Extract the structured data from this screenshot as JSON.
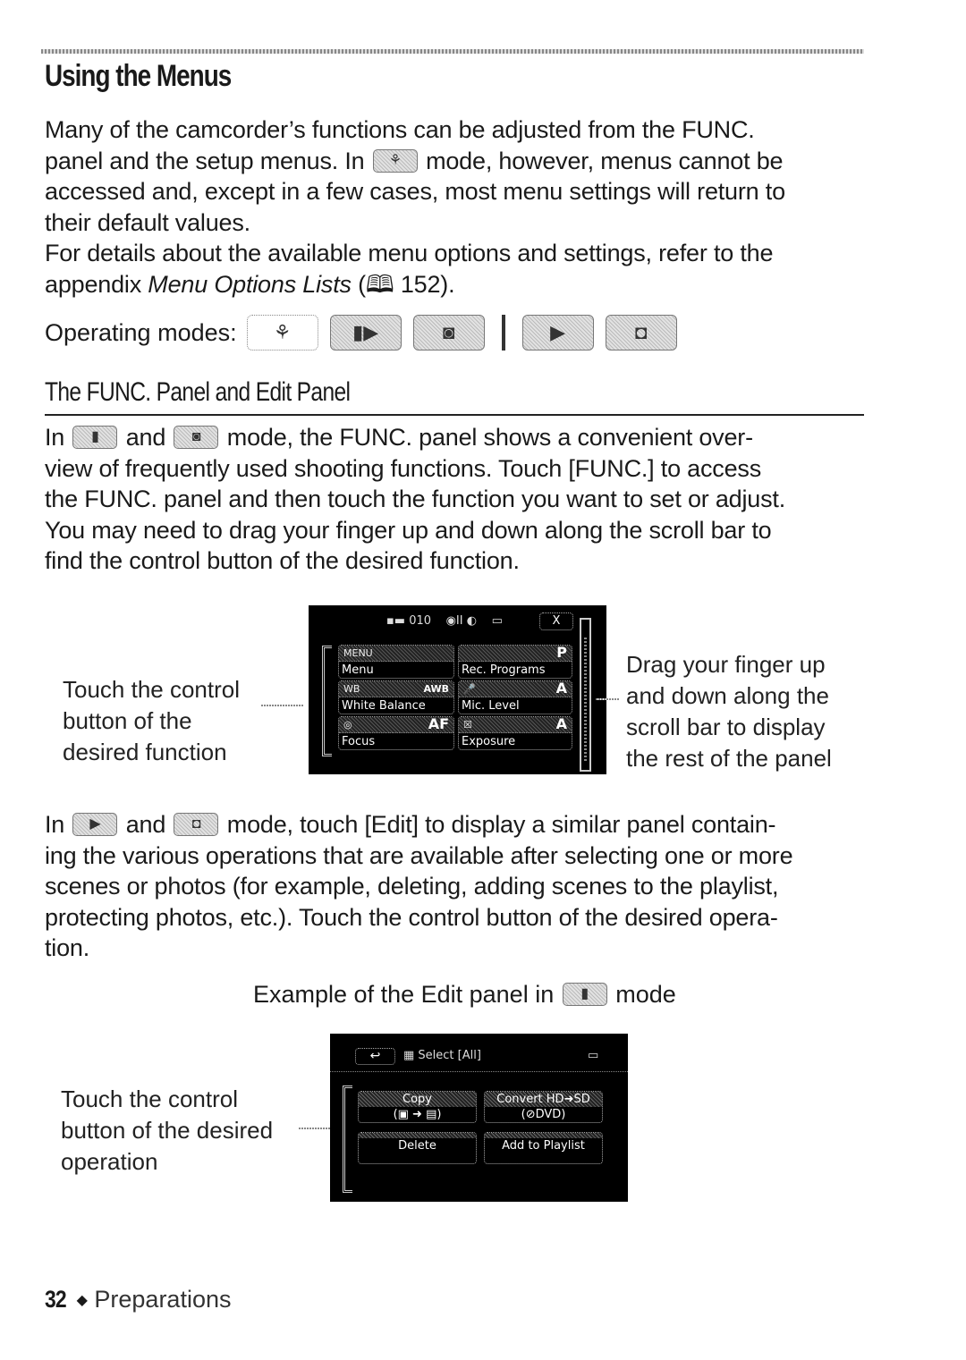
{
  "page": {
    "title": "Using the Menus",
    "intro_lines": [
      "Many of the camcorder’s functions can be adjusted from the FUNC.",
      [
        "panel and the setup menus. In ",
        "mode, however, menus cannot be"
      ],
      "accessed and, except in a few cases, most menu settings will return to",
      "their default values.",
      "For details about the available menu options and settings, refer to the",
      [
        "appendix ",
        "Menu Options Lists",
        " (",
        "📖",
        " 152)."
      ]
    ],
    "operating_modes_label": "Operating modes:",
    "modes": [
      {
        "icon": "auto-mode-icon",
        "glyph": "⚘",
        "active": false
      },
      {
        "icon": "movie-record-icon",
        "glyph": "🎥",
        "active": true
      },
      {
        "icon": "photo-record-icon",
        "glyph": "📷",
        "active": true
      },
      {
        "icon": "movie-playback-icon",
        "glyph": "▶",
        "active": true
      },
      {
        "icon": "photo-playback-icon",
        "glyph": "▶",
        "active": true
      }
    ],
    "section_heading": "The FUNC. Panel and Edit Panel",
    "func_para": {
      "l1_a": "In ",
      "l1_b": " and ",
      "l1_c": " mode, the FUNC. panel shows a convenient over-",
      "l2": "view of frequently used shooting functions. Touch [FUNC.] to access",
      "l3": "the FUNC. panel and then touch the function you want to set or adjust.",
      "l4": "You may need to drag your finger up and down along the scroll bar to",
      "l5": "find the control button of the desired function."
    },
    "func_caption_left": [
      "Touch the control",
      "button of the",
      "desired function"
    ],
    "func_caption_right": [
      "Drag your finger up",
      "and down along the",
      "scroll bar to display",
      "the rest of the panel"
    ],
    "func_panel": {
      "counter": "010",
      "close": "X",
      "buttons": [
        {
          "top": "MENU",
          "value": "",
          "label": "Menu"
        },
        {
          "top": "",
          "value": "P",
          "label": "Rec. Programs"
        },
        {
          "top": "WB",
          "value": "AWB",
          "label": "White Balance"
        },
        {
          "top": "🎤",
          "value": "A",
          "label": "Mic. Level"
        },
        {
          "top": "◎",
          "value": "AF",
          "label": "Focus"
        },
        {
          "top": "☒",
          "value": "A",
          "label": "Exposure"
        }
      ]
    },
    "edit_para": {
      "l1_a": "In ",
      "l1_b": " and ",
      "l1_c": " mode, touch [Edit] to display a similar panel contain-",
      "l2": "ing the various operations that are available after selecting one or more",
      "l3": "scenes or photos (for example, deleting, adding scenes to the playlist,",
      "l4": "protecting photos, etc.). Touch the control button of the desired opera-",
      "l5": "tion."
    },
    "example_caption": {
      "before": "Example of the Edit panel in ",
      "after": " mode"
    },
    "edit_caption_left": [
      "Touch the control",
      "button of the desired",
      "operation"
    ],
    "edit_panel": {
      "back": "↩",
      "select": "Select [All]",
      "buttons": [
        {
          "line1": "Copy",
          "line2": "(▣ ➜ ▤)"
        },
        {
          "line1": "Convert HD➜SD",
          "line2": "(⊘DVD)"
        },
        {
          "line1": "Delete",
          "line2": ""
        },
        {
          "line1": "Add to Playlist",
          "line2": ""
        }
      ]
    },
    "footer": {
      "page_number": "32",
      "bullet": "◆",
      "section": "Preparations"
    }
  }
}
